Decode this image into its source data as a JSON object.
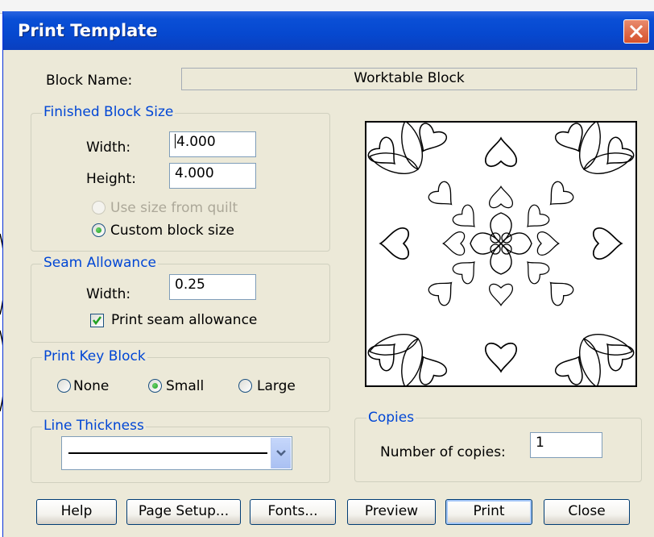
{
  "dialog": {
    "title": "Print Template",
    "block_name_label": "Block Name:",
    "block_name_value": "Worktable Block"
  },
  "finished_block_size": {
    "title": "Finished Block Size",
    "width_label": "Width:",
    "width_value": "4.000",
    "height_label": "Height:",
    "height_value": "4.000",
    "use_size_from_quilt": "Use size from quilt",
    "custom_block_size": "Custom block size",
    "selected": "custom"
  },
  "seam_allowance": {
    "title": "Seam Allowance",
    "width_label": "Width:",
    "width_value": "0.25",
    "print_seam_allowance": "Print seam allowance",
    "checked": true
  },
  "print_key_block": {
    "title": "Print Key Block",
    "options": [
      "None",
      "Small",
      "Large"
    ],
    "selected": "Small"
  },
  "line_thickness": {
    "title": "Line Thickness"
  },
  "copies": {
    "title": "Copies",
    "number_label": "Number of copies:",
    "number_value": "1"
  },
  "buttons": {
    "help": "Help",
    "page_setup": "Page Setup...",
    "fonts": "Fonts...",
    "preview": "Preview",
    "print": "Print",
    "close": "Close"
  },
  "colors": {
    "titlebar": "#0a4fd6",
    "dialog_bg": "#ece9d8",
    "group_title": "#0046d5",
    "close_button": "#d5502b"
  }
}
